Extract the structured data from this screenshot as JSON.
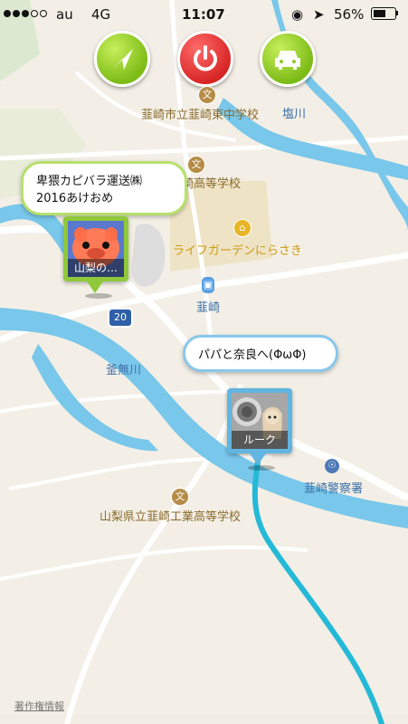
{
  "status_bar": {
    "carrier": "au",
    "network": "4G",
    "time": "11:07",
    "battery": "56%"
  },
  "controls": {
    "location_button": "location-arrow-icon",
    "power_button": "power-icon",
    "car_button": "car-icon"
  },
  "map_labels": {
    "school_1": "韮崎市立韮崎東中学校",
    "river_1": "塩川",
    "school_2": "韮崎高等学校",
    "shopping": "ライフガーデンにらさき",
    "station": "韮崎",
    "route": "20",
    "river_2": "釜無川",
    "police": "韮崎警察署",
    "school_3": "山梨県立韮崎工業高等学校",
    "copyright": "著作権情報"
  },
  "markers": [
    {
      "bubble": "卑猥カピバラ運送㈱\n2016あけおめ",
      "label": "山梨の…"
    },
    {
      "bubble": "パパと奈良へ(ΦωΦ)",
      "label": "ルーク"
    }
  ],
  "colors": {
    "accent_green": "#8fc93b",
    "accent_red": "#d82626",
    "route_blue": "#25b9d8",
    "water_blue": "#79c7ea"
  }
}
